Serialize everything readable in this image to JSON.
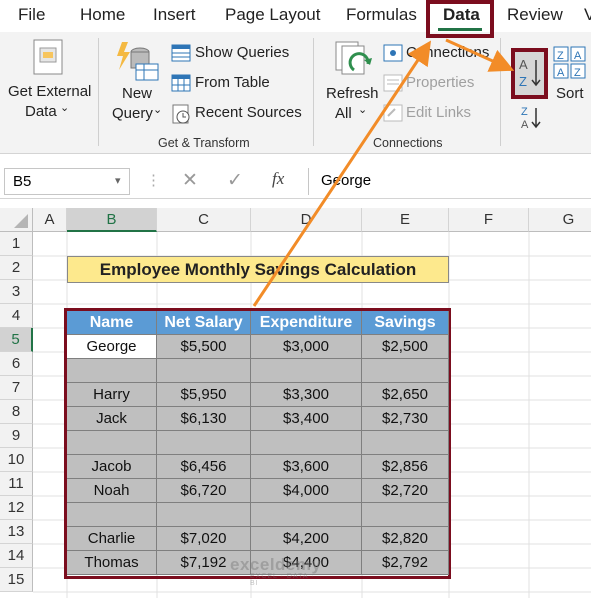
{
  "tabs": [
    "File",
    "Home",
    "Insert",
    "Page Layout",
    "Formulas",
    "Data",
    "Review",
    "V"
  ],
  "ribbon": {
    "get_external": [
      "Get External",
      "Data"
    ],
    "new_query": [
      "New",
      "Query"
    ],
    "show_queries": "Show Queries",
    "from_table": "From Table",
    "recent_sources": "Recent Sources",
    "group_get_transform": "Get & Transform",
    "refresh": [
      "Refresh",
      "All"
    ],
    "connections": "Connections",
    "properties": "Properties",
    "edit_links": "Edit Links",
    "group_connections": "Connections",
    "sort": "Sort",
    "sort_az": "A Z",
    "sort_za": "Z A"
  },
  "formula_bar": {
    "name_box": "B5",
    "fx": "fx",
    "content": "George"
  },
  "columns": [
    "A",
    "B",
    "C",
    "D",
    "E",
    "F",
    "G"
  ],
  "rows": [
    "1",
    "2",
    "3",
    "4",
    "5",
    "6",
    "7",
    "8",
    "9",
    "10",
    "11",
    "12",
    "13",
    "14",
    "15"
  ],
  "title": "Employee Monthly Savings Calculation",
  "table": {
    "headers": [
      "Name",
      "Net Salary",
      "Expenditure",
      "Savings"
    ],
    "rows": [
      [
        "George",
        "$5,500",
        "$3,000",
        "$2,500"
      ],
      [
        "",
        "",
        "",
        ""
      ],
      [
        "Harry",
        "$5,950",
        "$3,300",
        "$2,650"
      ],
      [
        "Jack",
        "$6,130",
        "$3,400",
        "$2,730"
      ],
      [
        "",
        "",
        "",
        ""
      ],
      [
        "Jacob",
        "$6,456",
        "$3,600",
        "$2,856"
      ],
      [
        "Noah",
        "$6,720",
        "$4,000",
        "$2,720"
      ],
      [
        "",
        "",
        "",
        ""
      ],
      [
        "Charlie",
        "$7,020",
        "$4,200",
        "$2,820"
      ],
      [
        "Thomas",
        "$7,192",
        "$4,400",
        "$2,792"
      ]
    ]
  },
  "watermark": [
    "exceldemy",
    "EXCEL · DATA · BI"
  ],
  "colors": {
    "accent": "#7b0d1e",
    "arrow": "#f28c28",
    "header": "#5b9bd5",
    "title_fill": "#fde98d",
    "excel_green": "#217346"
  }
}
